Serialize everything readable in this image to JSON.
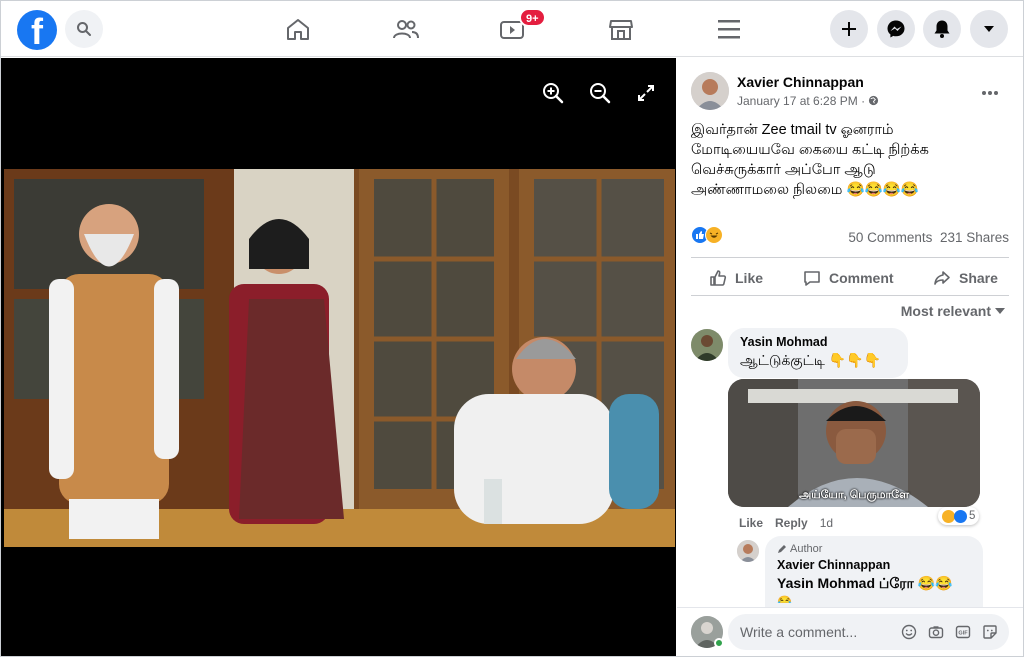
{
  "nav": {
    "logo": "f",
    "watch_badge": "9+",
    "icons": [
      "search-icon",
      "home-icon",
      "friends-icon",
      "watch-icon",
      "marketplace-icon",
      "menu-icon",
      "plus-icon",
      "messenger-icon",
      "notifications-icon",
      "account-dropdown-icon"
    ]
  },
  "viewer": {
    "tools": [
      "zoom-in-icon",
      "zoom-out-icon",
      "fullscreen-icon"
    ]
  },
  "post": {
    "author": "Xavier Chinnappan",
    "date": "January 17 at 6:28 PM · ",
    "text_lines": [
      "இவர்தான் Zee tmail tv ஓனராம்",
      "மோடியையவே கையை கட்டி நிற்க்க",
      "வெச்சுருக்கார் அப்போ ஆடு",
      "அண்ணாமலை நிலமை 😂😂😂😂"
    ],
    "reactions": [
      "like",
      "haha"
    ],
    "comments_count": "50 Comments",
    "shares_count": "231 Shares",
    "actions": {
      "like": "Like",
      "comment": "Comment",
      "share": "Share"
    },
    "sort_label": "Most relevant"
  },
  "comments": [
    {
      "name": "Yasin Mohmad",
      "text": "ஆட்டுக்குட்டி 👇👇👇",
      "meme_caption": "அய்யோ, பெருமாளே",
      "like": "Like",
      "reply": "Reply",
      "time": "1d",
      "reaction_count": "5"
    }
  ],
  "reply": {
    "author_tag": "Author",
    "name": "Xavier Chinnappan",
    "text": "Yasin Mohmad ப்ரோ 😂😂",
    "overflow_emoji": "😂"
  },
  "composer": {
    "placeholder": "Write a comment..."
  },
  "colors": {
    "brand": "#1877f2",
    "badge": "#e41e3f",
    "secondary_text": "#65676b",
    "bubble": "#f0f2f5"
  }
}
